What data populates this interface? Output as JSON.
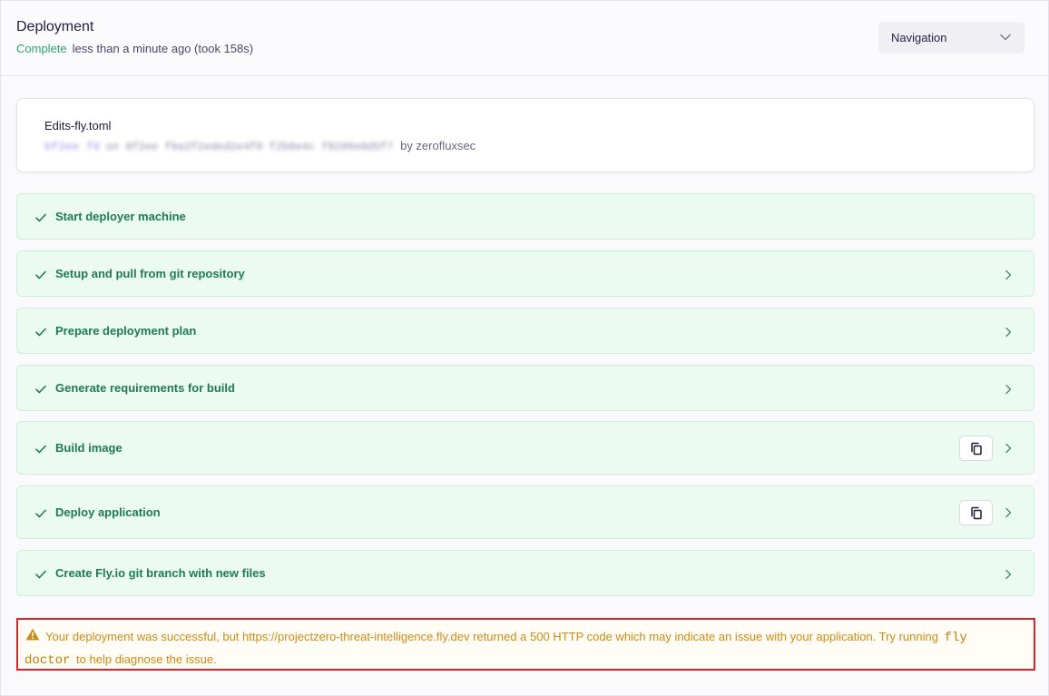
{
  "header": {
    "title": "Deployment",
    "status": "Complete",
    "status_detail": "less than a minute ago (took 158s)",
    "nav_label": "Navigation"
  },
  "commit": {
    "file": "Edits-fly.toml",
    "hash_blurred": "bf2ee f6",
    "ref_blurred": "on 8f2ee f6a2f2eded2e4f0 f2b0e4c f8209e0d5f7",
    "author": "by zerofluxsec"
  },
  "steps": [
    {
      "label": "Start deployer machine",
      "expandable": false,
      "copyable": false
    },
    {
      "label": "Setup and pull from git repository",
      "expandable": true,
      "copyable": false
    },
    {
      "label": "Prepare deployment plan",
      "expandable": true,
      "copyable": false
    },
    {
      "label": "Generate requirements for build",
      "expandable": true,
      "copyable": false
    },
    {
      "label": "Build image",
      "expandable": true,
      "copyable": true
    },
    {
      "label": "Deploy application",
      "expandable": true,
      "copyable": true
    },
    {
      "label": "Create Fly.io git branch with new files",
      "expandable": true,
      "copyable": false
    }
  ],
  "warning": {
    "text_before": "Your deployment was successful, but https://projectzero-threat-intelligence.fly.dev returned a 500 HTTP code which may indicate an issue with your application. Try running",
    "command": "fly doctor",
    "text_after": "to help diagnose the issue."
  },
  "colors": {
    "success": "#2fa56b",
    "step_bg": "#ebfbf2",
    "step_text": "#1f7a53",
    "warning_text": "#d08a14",
    "highlight_border": "#e0222a"
  },
  "icons": {
    "step_status": "check-icon",
    "step_expand": "chevron-right-icon",
    "step_copy": "copy-icon",
    "nav": "chevron-down-icon",
    "warning": "warning-triangle-icon"
  }
}
